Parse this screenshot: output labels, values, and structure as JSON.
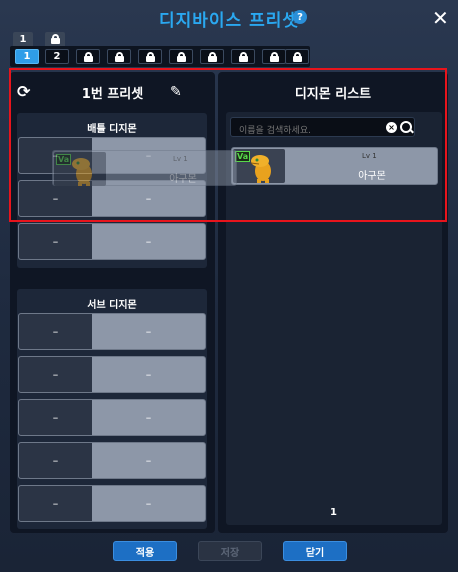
{
  "title": "디지바이스 프리셋",
  "help_glyph": "?",
  "close_glyph": "✕",
  "top_tabs": [
    "1"
  ],
  "preset_tabs": [
    {
      "label": "1",
      "locked": false,
      "active": true
    },
    {
      "label": "2",
      "locked": false,
      "active": false
    },
    {
      "label": "",
      "locked": true
    },
    {
      "label": "",
      "locked": true
    },
    {
      "label": "",
      "locked": true
    },
    {
      "label": "",
      "locked": true
    },
    {
      "label": "",
      "locked": true
    },
    {
      "label": "",
      "locked": true
    },
    {
      "label": "",
      "locked": true
    },
    {
      "label": "",
      "locked": true
    }
  ],
  "left_panel": {
    "title": "1번 프리셋",
    "battle_title": "배틀 디지몬",
    "sub_title": "서브 디지몬",
    "empty": "–"
  },
  "right_panel": {
    "title": "디지몬 리스트",
    "search_placeholder": "이름을 검색하세요.",
    "clear_glyph": "×",
    "items": [
      {
        "badge": "Va",
        "level": "Lv 1",
        "name": "아구몬"
      }
    ],
    "page": "1"
  },
  "drag_ghost": {
    "badge": "Va",
    "level": "Lv 1",
    "name": "아구몬"
  },
  "buttons": {
    "apply": "적용",
    "save": "저장",
    "close": "닫기"
  },
  "colors": {
    "accent": "#2aa8f0",
    "highlight": "#e8141c",
    "badge": "#58d84a"
  }
}
